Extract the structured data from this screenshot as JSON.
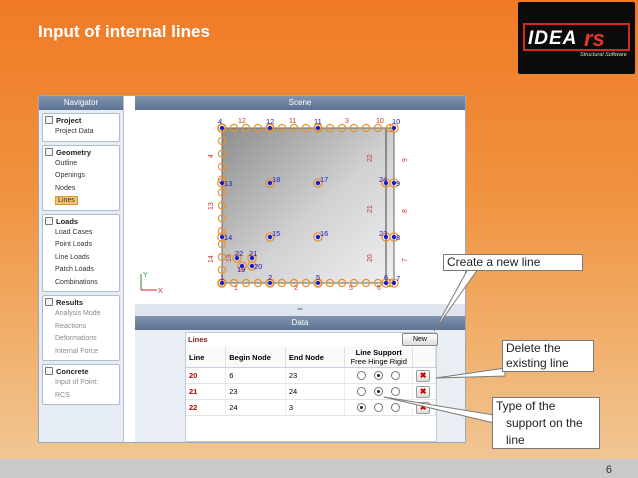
{
  "slide": {
    "title": "Input of internal lines",
    "page_number": "6"
  },
  "logo": {
    "brand": "IDEA",
    "suffix": "rs",
    "tagline": "Structural Software"
  },
  "navigator": {
    "title": "Navigator",
    "groups": [
      {
        "label": "Project",
        "items": [
          {
            "label": "Project Data",
            "state": "normal"
          }
        ]
      },
      {
        "label": "Geometry",
        "items": [
          {
            "label": "Outline",
            "state": "normal"
          },
          {
            "label": "Openings",
            "state": "normal"
          },
          {
            "label": "Nodes",
            "state": "normal"
          },
          {
            "label": "Lines",
            "state": "selected"
          }
        ]
      },
      {
        "label": "Loads",
        "items": [
          {
            "label": "Load Cases",
            "state": "normal"
          },
          {
            "label": "Point Loads",
            "state": "normal"
          },
          {
            "label": "Line Loads",
            "state": "normal"
          },
          {
            "label": "Patch Loads",
            "state": "normal"
          },
          {
            "label": "Combinations",
            "state": "normal"
          }
        ]
      },
      {
        "label": "Results",
        "items": [
          {
            "label": "Analysis Mode",
            "state": "disabled"
          },
          {
            "label": "Reactions",
            "state": "disabled"
          },
          {
            "label": "Deformations",
            "state": "disabled"
          },
          {
            "label": "Internal Force",
            "state": "disabled"
          }
        ]
      },
      {
        "label": "Concrete",
        "items": [
          {
            "label": "Input of Point:",
            "state": "disabled"
          },
          {
            "label": "RCS",
            "state": "disabled"
          }
        ]
      }
    ]
  },
  "scene": {
    "title": "Scene",
    "axis_y": "Y",
    "axis_x": "X",
    "node_labels": [
      {
        "text": "4"
      },
      {
        "text": "12"
      },
      {
        "text": "11"
      },
      {
        "text": "10"
      },
      {
        "text": "13"
      },
      {
        "text": "18"
      },
      {
        "text": "17"
      },
      {
        "text": "24"
      },
      {
        "text": "9"
      },
      {
        "text": "14"
      },
      {
        "text": "15"
      },
      {
        "text": "16"
      },
      {
        "text": "23"
      },
      {
        "text": "8"
      },
      {
        "text": "22"
      },
      {
        "text": "21"
      },
      {
        "text": "19"
      },
      {
        "text": "20"
      },
      {
        "text": "1"
      },
      {
        "text": "2"
      },
      {
        "text": "5"
      },
      {
        "text": "6"
      },
      {
        "text": "7"
      }
    ],
    "line_labels": [
      {
        "text": "12"
      },
      {
        "text": "11"
      },
      {
        "text": "3"
      },
      {
        "text": "10"
      },
      {
        "text": "4"
      },
      {
        "text": "13"
      },
      {
        "text": "14"
      },
      {
        "text": "22"
      },
      {
        "text": "21"
      },
      {
        "text": "20"
      },
      {
        "text": "9"
      },
      {
        "text": "8"
      },
      {
        "text": "7"
      },
      {
        "text": "1"
      },
      {
        "text": "2"
      },
      {
        "text": "5"
      },
      {
        "text": "6"
      },
      {
        "text": "19"
      }
    ]
  },
  "data_panel": {
    "title": "Data",
    "splitter_glyph": "═",
    "lines_title": "Lines",
    "new_button": "New",
    "columns": {
      "line": "Line",
      "begin": "Begin Node",
      "end": "End Node",
      "support": "Line Support",
      "support_sub": "Free Hinge Rigid"
    },
    "rows": [
      {
        "line": "20",
        "begin": "6",
        "end": "23",
        "support": "hinge",
        "delete": "✖"
      },
      {
        "line": "21",
        "begin": "23",
        "end": "24",
        "support": "hinge",
        "delete": "✖"
      },
      {
        "line": "22",
        "begin": "24",
        "end": "3",
        "support": "free",
        "delete": "✖"
      }
    ]
  },
  "callouts": {
    "new_line": "Create a new line",
    "delete_line_1": "Delete the",
    "delete_line_2": "existing line",
    "support_1": "Type of the",
    "support_2": "support on the",
    "support_3": "line"
  },
  "colors": {
    "node": "#1a1ac8",
    "support": "#e8932b",
    "line_label": "#c0392b",
    "accent": "#f07a26"
  }
}
